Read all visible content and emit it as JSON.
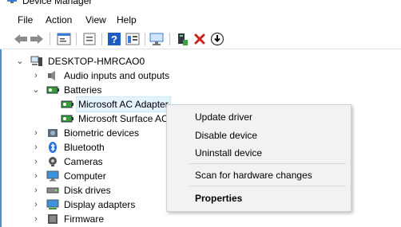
{
  "window": {
    "title": "Device Manager"
  },
  "menu": [
    "File",
    "Action",
    "View",
    "Help"
  ],
  "toolbar_icons": [
    "back-icon",
    "forward-icon",
    "properties-icon",
    "update-icon",
    "help-icon",
    "view-icon",
    "scan-monitor-icon",
    "install-driver-icon",
    "uninstall-icon",
    "download-icon"
  ],
  "tree": {
    "root": "DESKTOP-HMRCAO0",
    "items": [
      {
        "label": "Audio inputs and outputs",
        "expanded": false
      },
      {
        "label": "Batteries",
        "expanded": true
      },
      {
        "label": "Microsoft AC Adapter",
        "child": true,
        "selected": true
      },
      {
        "label": "Microsoft Surface ACP",
        "child": true
      },
      {
        "label": "Biometric devices",
        "expanded": false
      },
      {
        "label": "Bluetooth",
        "expanded": false
      },
      {
        "label": "Cameras",
        "expanded": false
      },
      {
        "label": "Computer",
        "expanded": false
      },
      {
        "label": "Disk drives",
        "expanded": false
      },
      {
        "label": "Display adapters",
        "expanded": false
      },
      {
        "label": "Firmware",
        "expanded": false
      }
    ]
  },
  "context_menu": {
    "update_driver": "Update driver",
    "disable_device": "Disable device",
    "uninstall_device": "Uninstall device",
    "scan": "Scan for hardware changes",
    "properties": "Properties"
  }
}
